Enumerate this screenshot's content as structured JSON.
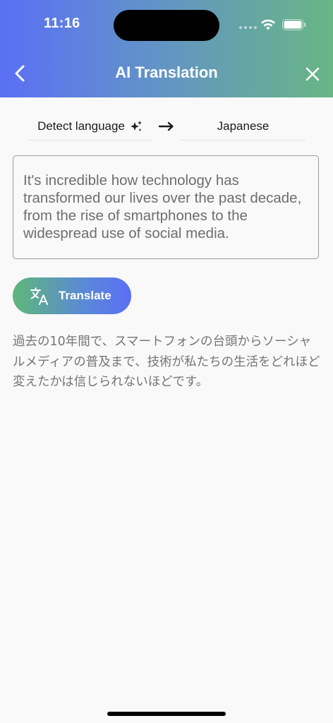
{
  "status_bar": {
    "time": "11:16"
  },
  "nav": {
    "title": "AI Translation",
    "back_icon": "chevron-left-icon",
    "close_icon": "close-icon"
  },
  "languages": {
    "source_label": "Detect language",
    "source_icon": "sparkle-icon",
    "swap_icon": "arrow-right-icon",
    "target_label": "Japanese"
  },
  "input": {
    "text": "It's incredible how technology has transformed our lives over the past decade, from the rise of smartphones to the widespread use of social media."
  },
  "translate_button": {
    "label": "Translate",
    "icon": "translate-icon"
  },
  "result": {
    "text": "過去の10年間で、スマートフォンの台頭からソーシャルメディアの普及まで、技術が私たちの生活をどれほど変えたかは信じられないほどです。"
  },
  "colors": {
    "header_gradient_start": "#5a6ff5",
    "header_gradient_end": "#68b684",
    "button_gradient_start": "#5fb779",
    "button_gradient_end": "#5a6ff5",
    "background": "#f9f9f9"
  }
}
